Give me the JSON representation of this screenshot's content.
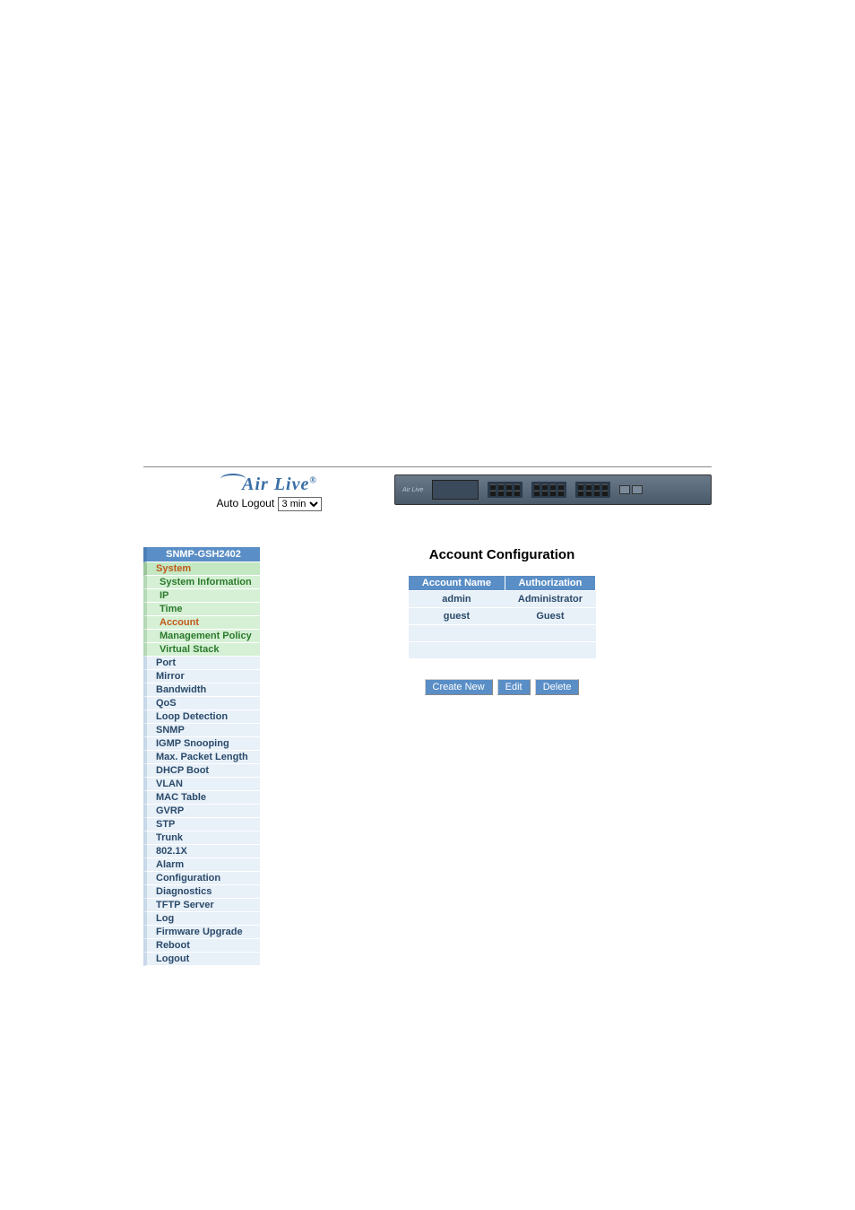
{
  "brand": "Air Live",
  "auto_logout_label": "Auto Logout",
  "auto_logout_value": "3 min",
  "sidebar": {
    "title": "SNMP-GSH2402",
    "system_label": "System",
    "system_children": [
      "System Information",
      "IP",
      "Time",
      "Account",
      "Management Policy",
      "Virtual Stack"
    ],
    "active_child_index": 3,
    "items": [
      "Port",
      "Mirror",
      "Bandwidth",
      "QoS",
      "Loop Detection",
      "SNMP",
      "IGMP Snooping",
      "Max. Packet Length",
      "DHCP Boot",
      "VLAN",
      "MAC Table",
      "GVRP",
      "STP",
      "Trunk",
      "802.1X",
      "Alarm",
      "Configuration",
      "Diagnostics",
      "TFTP Server",
      "Log",
      "Firmware Upgrade",
      "Reboot",
      "Logout"
    ]
  },
  "main": {
    "title": "Account Configuration",
    "col_account": "Account Name",
    "col_auth": "Authorization",
    "rows": [
      {
        "name": "admin",
        "auth": "Administrator"
      },
      {
        "name": "guest",
        "auth": "Guest"
      }
    ],
    "btn_create": "Create New",
    "btn_edit": "Edit",
    "btn_delete": "Delete"
  }
}
